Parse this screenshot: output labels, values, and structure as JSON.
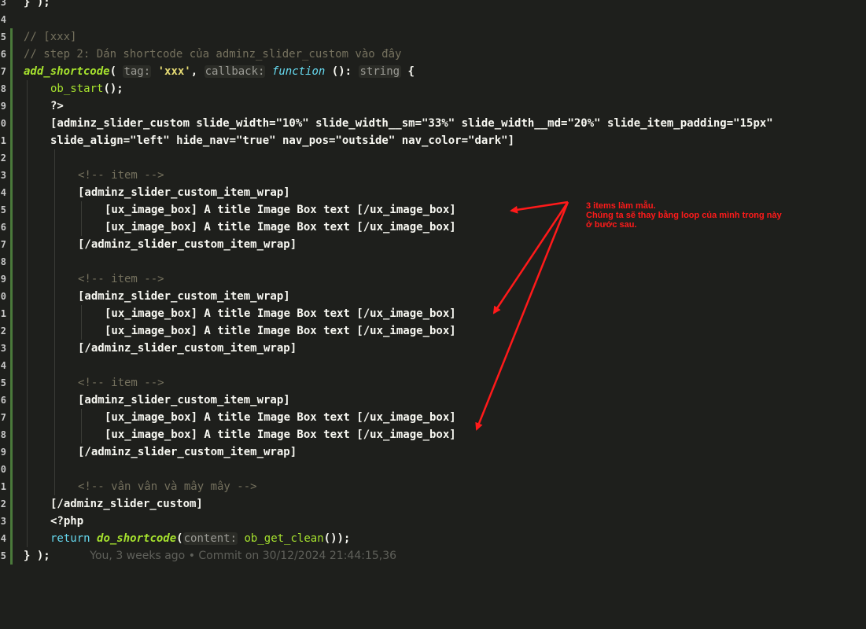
{
  "editor": {
    "line_numbers": [
      "3",
      "4",
      "5",
      "6",
      "7",
      "8",
      "9",
      "0",
      "1",
      "2",
      "3",
      "4",
      "5",
      "6",
      "7",
      "8",
      "9",
      "0",
      "1",
      "2",
      "3",
      "4",
      "5",
      "6",
      "7",
      "8",
      "9",
      "0",
      "1",
      "2",
      "3",
      "4",
      "5"
    ],
    "lines": {
      "l1": "} );",
      "l3_comment": "// [xxx]",
      "l4_comment": "// step 2: Dán shortcode của adminz_slider_custom vào đây",
      "l5_fn": "add_shortcode",
      "l5_open": "( ",
      "l5_hint_tag": "tag:",
      "l5_str": "'xxx'",
      "l5_comma": ", ",
      "l5_hint_cb": "callback:",
      "l5_kw": "function",
      "l5_paren": " (): ",
      "l5_type": "string",
      "l5_brace": " {",
      "l6": "ob_start",
      "l6_rest": "();",
      "l7": "?>",
      "l8": "[adminz_slider_custom slide_width=\"10%\" slide_width__sm=\"33%\" slide_width__md=\"20%\" slide_item_padding=\"15px\"",
      "l9": "slide_align=\"left\" hide_nav=\"true\" nav_pos=\"outside\" nav_color=\"dark\"]",
      "item_comment": "<!-- item -->",
      "wrap_open": "[adminz_slider_custom_item_wrap]",
      "image_box": "[ux_image_box] A title Image Box text [/ux_image_box]",
      "wrap_close": "[/adminz_slider_custom_item_wrap]",
      "etc_comment": "<!-- vân vân và mây mây -->",
      "slider_close": "[/adminz_slider_custom]",
      "php_open": "<?php",
      "ret_kw": "return",
      "ret_fn": "do_shortcode",
      "ret_open": "(",
      "ret_hint": "content:",
      "ret_fn2": "ob_get_clean",
      "ret_close": "());",
      "last": "} );",
      "blame": "You, 3 weeks ago • Commit on 30/12/2024 21:44:15,36"
    }
  },
  "annotation": {
    "line1": "3 items làm mẫu.",
    "line2": "Chúng ta sẽ thay bằng loop của mình trong này",
    "line3": "ở bước sau.",
    "color": "#ff1a1a"
  },
  "colors": {
    "background": "#1e1f1c",
    "comment": "#75715e",
    "function": "#a6e22e",
    "keyword": "#66d9ef",
    "string": "#e6db74"
  }
}
